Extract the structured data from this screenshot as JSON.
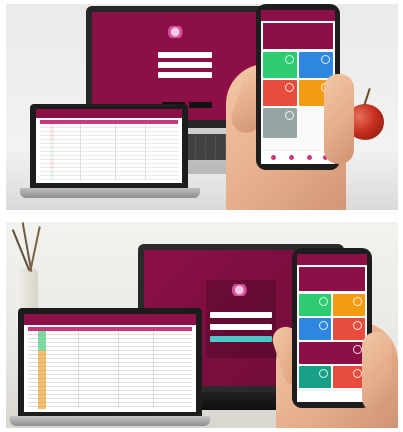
{
  "panels": {
    "top": {
      "laptop_large": {
        "screen_label": ""
      },
      "laptop_small": {
        "sheet_title": ""
      },
      "phone": {
        "header": ""
      }
    },
    "bottom": {
      "laptop_large": {
        "screen_label": ""
      },
      "laptop_small": {
        "sheet_title": ""
      },
      "phone": {
        "header": ""
      }
    }
  },
  "colors": {
    "brand": "#8c1046",
    "brand_dark": "#6c0c37",
    "accent_button": "#4ec7c9",
    "tile_green": "#2ecc71",
    "tile_red": "#e74c3c",
    "tile_yellow": "#f1c40f",
    "tile_blue": "#2e86de",
    "tile_orange": "#f39c12",
    "tile_grey": "#95a5a6"
  },
  "objects": {
    "apple": "red-apple",
    "plant": "dried-branches-vase"
  }
}
